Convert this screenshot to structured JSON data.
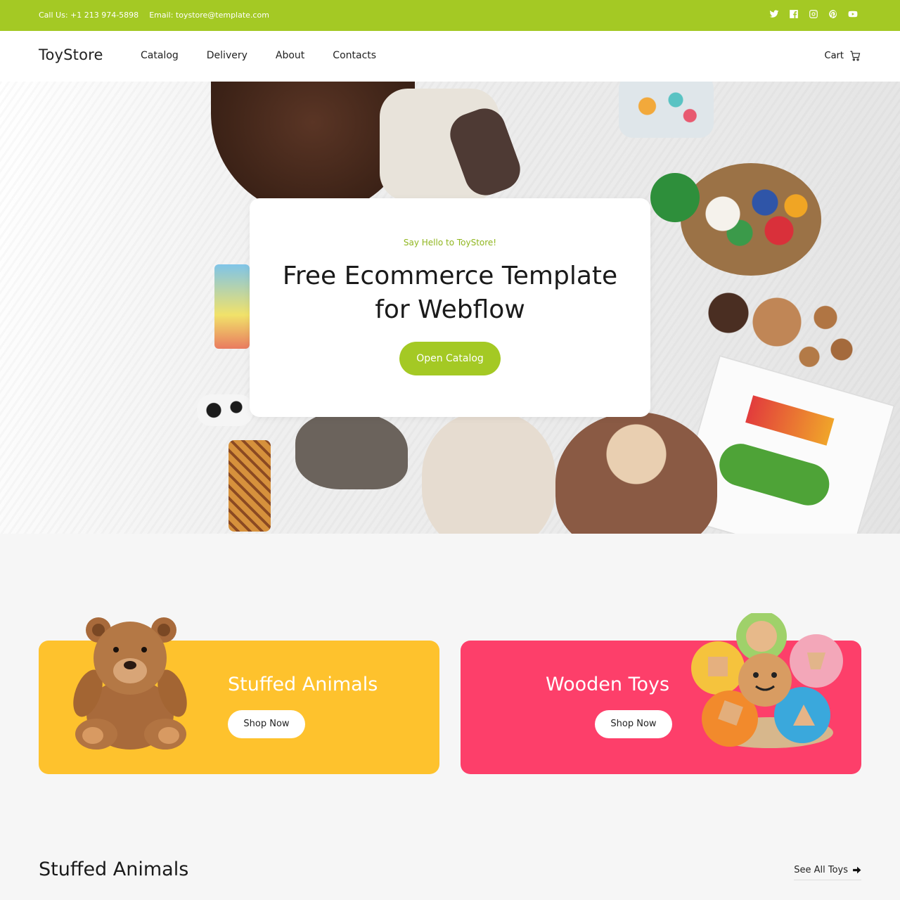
{
  "topbar": {
    "phone": "Call Us: +1 213 974-5898",
    "email": "Email: toystore@template.com",
    "social": [
      "twitter-icon",
      "facebook-icon",
      "instagram-icon",
      "pinterest-icon",
      "youtube-icon"
    ]
  },
  "nav": {
    "logo": "ToyStore",
    "links": [
      "Catalog",
      "Delivery",
      "About",
      "Contacts"
    ],
    "cart": "Cart"
  },
  "hero": {
    "kicker": "Say Hello to ToyStore!",
    "title": "Free Ecommerce Template for Webflow",
    "button": "Open Catalog"
  },
  "categories": [
    {
      "title": "Stuffed Animals",
      "button": "Shop Now",
      "color": "#fec22d"
    },
    {
      "title": "Wooden Toys",
      "button": "Shop Now",
      "color": "#fd3f6a"
    }
  ],
  "section": {
    "title": "Stuffed Animals",
    "see_all": "See All Toys"
  },
  "colors": {
    "accent": "#a4c924",
    "yellow": "#fec22d",
    "pink": "#fd3f6a"
  }
}
